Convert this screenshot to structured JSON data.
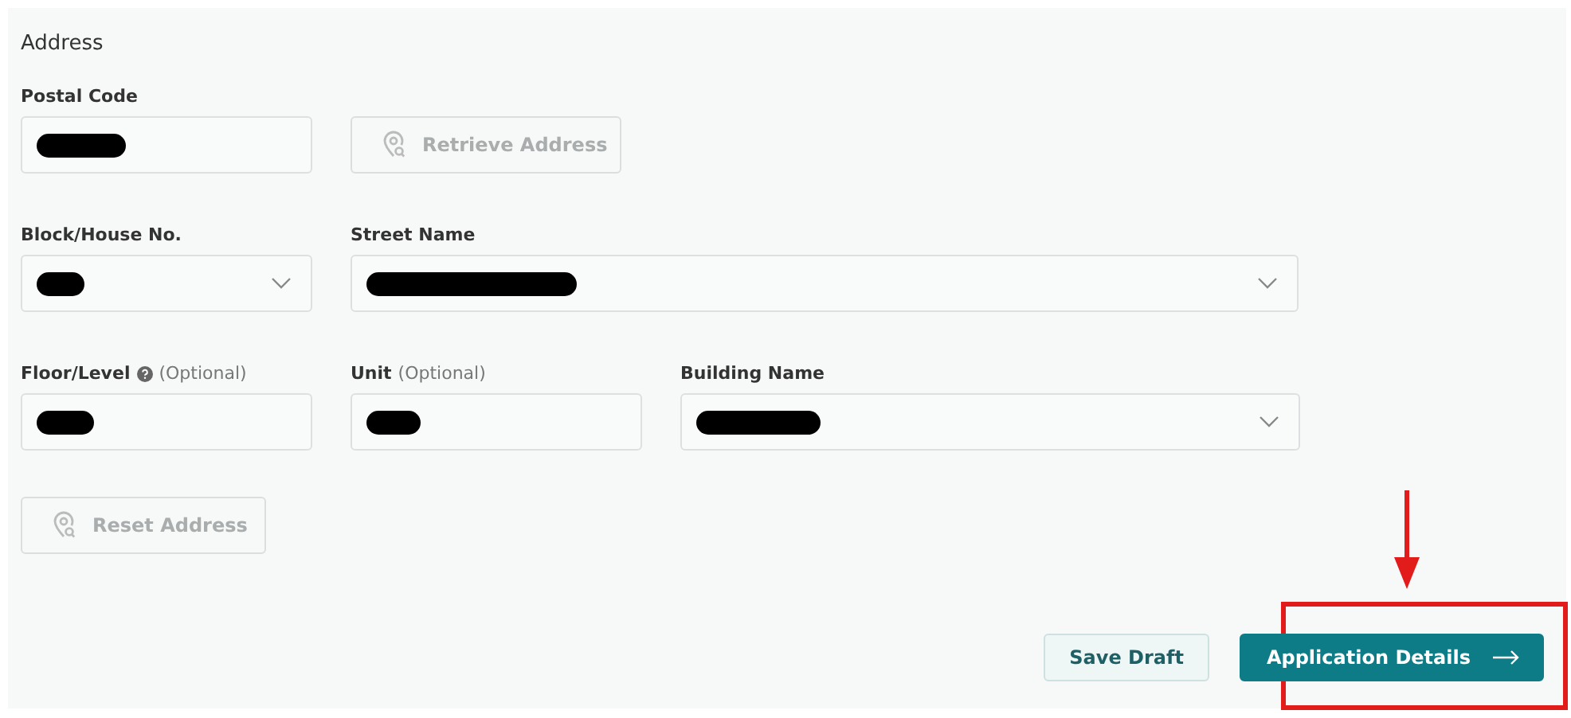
{
  "section_title": "Address",
  "rows": [
    [
      {
        "kind": "input",
        "label": "Postal Code",
        "redacted": true
      },
      {
        "kind": "button",
        "label": "Retrieve Address",
        "disabled": true
      }
    ],
    [
      {
        "kind": "select",
        "label": "Block/House No.",
        "redacted": true
      },
      {
        "kind": "select",
        "label": "Street Name",
        "redacted": true
      }
    ],
    [
      {
        "kind": "input",
        "label": "Floor/Level",
        "optional": "(Optional)",
        "help": true,
        "redacted": true
      },
      {
        "kind": "input",
        "label": "Unit",
        "optional": "(Optional)",
        "redacted": true
      },
      {
        "kind": "select",
        "label": "Building Name",
        "redacted": true
      }
    ],
    [
      {
        "kind": "button",
        "label": "Reset Address",
        "disabled": true
      }
    ]
  ],
  "actions": [
    {
      "kind": "secondary",
      "label": "Save Draft"
    },
    {
      "kind": "primary",
      "label": "Application Details",
      "highlighted": true
    }
  ]
}
